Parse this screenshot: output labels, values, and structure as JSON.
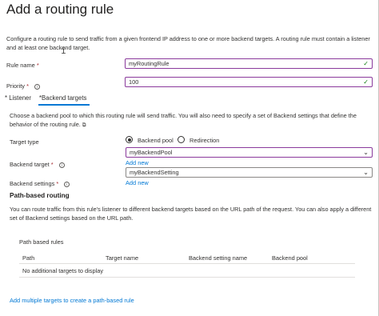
{
  "header": {
    "title": "Add a routing rule"
  },
  "intro": {
    "description": "Configure a routing rule to send traffic from a given frontend IP address to one or more backend targets. A routing rule must contain a listener and at least one backend target."
  },
  "form": {
    "rule_name": {
      "label": "Rule name",
      "required_mark": "*",
      "value": "myRoutingRule"
    },
    "priority": {
      "label": "Priority",
      "required_mark": "*",
      "value": "100",
      "info_icon": "i"
    }
  },
  "tabs": [
    {
      "label": "Listener",
      "prefix": "*"
    },
    {
      "label": "Backend targets",
      "prefix": "*",
      "selected": true
    }
  ],
  "backend": {
    "description": "Choose a backend pool to which this routing rule will send traffic. You will also need to specify a set of Backend settings that define the behavior of the routing rule.",
    "external_icon": "external-link-icon",
    "target_type": {
      "label": "Target type",
      "options": [
        {
          "label": "Backend pool",
          "checked": true
        },
        {
          "label": "Redirection",
          "checked": false
        }
      ]
    },
    "backend_target": {
      "label": "Backend target",
      "required_mark": "*",
      "value": "myBackendPool",
      "add_new": "Add new"
    },
    "backend_settings": {
      "label": "Backend settings",
      "required_mark": "*",
      "value": "myBackendSetting",
      "add_new": "Add new"
    }
  },
  "path_routing": {
    "title": "Path-based routing",
    "description": "You can route traffic from this rule's listener to different backend targets based on the URL path of the request. You can also apply a different set of Backend settings based on the URL path.",
    "rules_title": "Path based rules",
    "columns": [
      "Path",
      "Target name",
      "Backend setting name",
      "Backend pool"
    ],
    "empty_message": "No additional targets to display",
    "add_link": "Add multiple targets to create a path-based rule"
  },
  "colors": {
    "accent": "#0078d4",
    "focus_border": "#8a3a9c",
    "required": "#a4262c",
    "success": "#107c10"
  }
}
